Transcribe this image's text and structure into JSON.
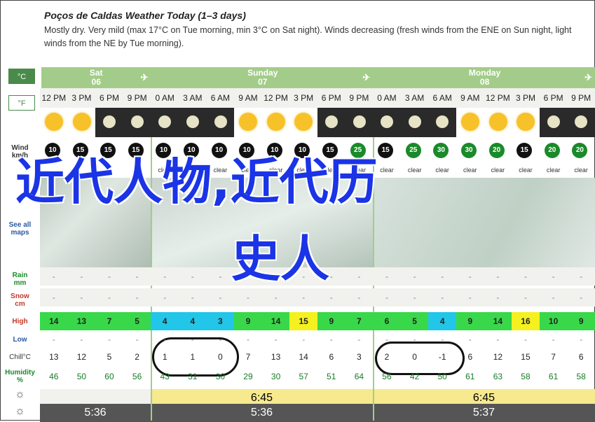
{
  "header": {
    "title": "Poços de Caldas Weather Today (1–3 days)",
    "description": "Mostly dry. Very mild (max 17°C on Tue morning, min 3°C on Sat night). Winds decreasing (fresh winds from the ENE on Sun night, light winds from the NE by Tue morning)."
  },
  "units": {
    "celsius": "°C",
    "fahrenheit": "°F"
  },
  "labels": {
    "wind": "Wind\nkm/h",
    "see_maps": "See all maps",
    "rain": "Rain\nmm",
    "snow": "Snow\ncm",
    "high": "High",
    "low": "Low",
    "chill": "Chill°C",
    "humidity": "Humidity\n%"
  },
  "days": [
    {
      "name": "Sat",
      "date": "06"
    },
    {
      "name": "Sunday",
      "date": "07"
    },
    {
      "name": "Monday",
      "date": "08"
    }
  ],
  "times": [
    "12 PM",
    "3 PM",
    "6 PM",
    "9 PM",
    "0 AM",
    "3 AM",
    "6 AM",
    "9 AM",
    "12 PM",
    "3 PM",
    "6 PM",
    "9 PM",
    "0 AM",
    "3 AM",
    "6 AM",
    "9 AM",
    "12 PM",
    "3 PM",
    "6 PM",
    "9 PM"
  ],
  "sky": [
    "sun",
    "sun",
    "moon",
    "moon",
    "moon",
    "moon",
    "moon",
    "sun",
    "sun",
    "sun",
    "moon",
    "moon",
    "moon",
    "moon",
    "moon",
    "sun",
    "sun",
    "sun",
    "moon",
    "moon"
  ],
  "wind": [
    "10",
    "15",
    "15",
    "15",
    "10",
    "10",
    "10",
    "10",
    "10",
    "10",
    "15",
    "25",
    "15",
    "25",
    "30",
    "30",
    "20",
    "15",
    "20",
    "20"
  ],
  "wind_text": [
    "",
    "",
    "",
    "",
    "clear",
    "clear",
    "clear",
    "clear",
    "clear",
    "clear",
    "clear",
    "clear",
    "clear",
    "clear",
    "clear",
    "clear",
    "clear",
    "clear",
    "clear",
    "clear"
  ],
  "rain": [
    "-",
    "-",
    "-",
    "-",
    "-",
    "-",
    "-",
    "-",
    "-",
    "-",
    "-",
    "-",
    "-",
    "-",
    "-",
    "-",
    "-",
    "-",
    "-",
    "-"
  ],
  "snow": [
    "-",
    "-",
    "-",
    "-",
    "-",
    "-",
    "-",
    "-",
    "-",
    "-",
    "-",
    "-",
    "-",
    "-",
    "-",
    "-",
    "-",
    "-",
    "-",
    "-"
  ],
  "high": [
    "14",
    "13",
    "7",
    "5",
    "4",
    "4",
    "3",
    "9",
    "14",
    "15",
    "9",
    "7",
    "6",
    "5",
    "4",
    "9",
    "14",
    "16",
    "10",
    "9"
  ],
  "low": [
    "-",
    "-",
    "-",
    "-",
    "-",
    "-",
    "-",
    "-",
    "-",
    "-",
    "-",
    "-",
    "-",
    "-",
    "-",
    "-",
    "-",
    "-",
    "-",
    "-"
  ],
  "chill": [
    "13",
    "12",
    "5",
    "2",
    "1",
    "1",
    "0",
    "7",
    "13",
    "14",
    "6",
    "3",
    "2",
    "0",
    "-1",
    "6",
    "12",
    "15",
    "7",
    "6"
  ],
  "humidity": [
    "46",
    "50",
    "60",
    "56",
    "43",
    "31",
    "30",
    "29",
    "30",
    "57",
    "51",
    "64",
    "56",
    "42",
    "50",
    "61",
    "63",
    "58",
    "61",
    "58"
  ],
  "sunrise_label": "6:45",
  "sunset_label": "5:36",
  "sunset2_label": "5:36",
  "sunset3_label": "5:37",
  "sunrise2_label": "6:45",
  "colors": {
    "day_header": "#a3cc8a",
    "high_cyan": "#22c6e8",
    "high_green": "#39d84a",
    "high_yellow": "#f5f020",
    "overlay_text": "#1a34e6"
  },
  "overlay": {
    "line1": "近代人物,近代历",
    "line2": "史人"
  }
}
